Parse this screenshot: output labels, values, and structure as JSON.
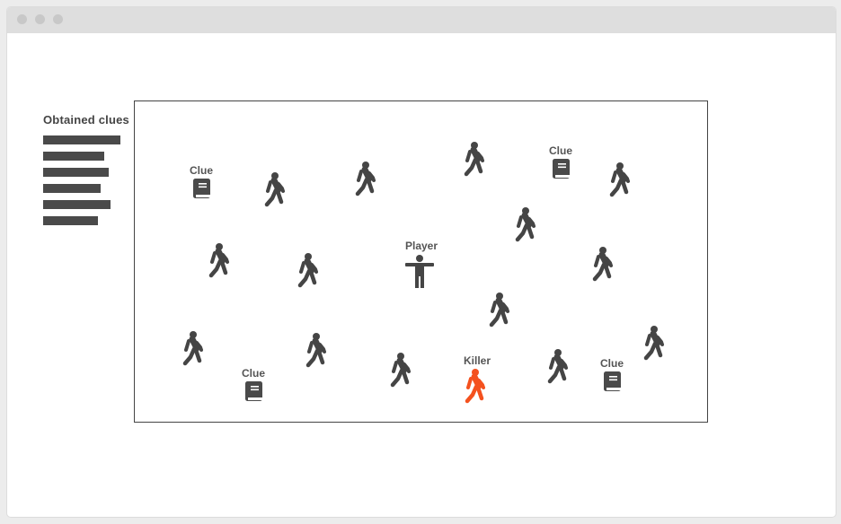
{
  "window": {
    "controls": [
      "close",
      "minimize",
      "maximize"
    ]
  },
  "clues_panel": {
    "title": "Obtained clues",
    "bars": [
      1.0,
      0.79,
      0.85,
      0.74,
      0.87,
      0.71
    ]
  },
  "labels": {
    "player": "Player",
    "killer": "Killer",
    "clue": "Clue"
  },
  "icons": {
    "walker": "walking-person-icon",
    "player": "standing-person-icon",
    "clue": "book-icon"
  },
  "colors": {
    "walker": "#454545",
    "killer": "#f4511e",
    "clue": "#4a4a4a"
  }
}
